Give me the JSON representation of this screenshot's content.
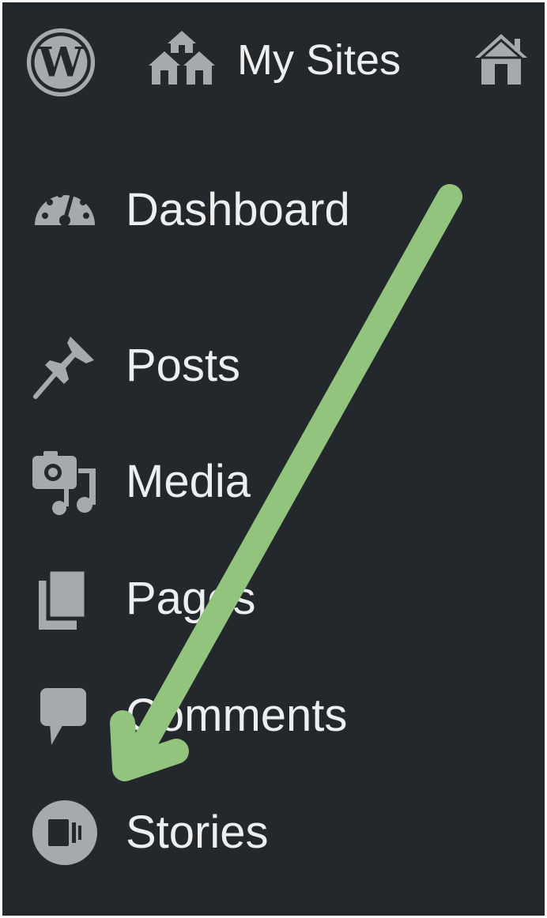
{
  "colors": {
    "sidebar_bg": "#23282d",
    "icon_gray": "#a7aaad",
    "text": "#eeeeee",
    "annotation_arrow": "#93c47d"
  },
  "top_bar": {
    "logo_icon": "wordpress-logo-icon",
    "my_sites_icon": "my-sites-houses-icon",
    "my_sites_label": "My Sites",
    "home_icon": "home-icon"
  },
  "menu": {
    "items": [
      {
        "label": "Dashboard",
        "icon": "dashboard-gauge-icon"
      },
      {
        "label": "Posts",
        "icon": "pushpin-icon"
      },
      {
        "label": "Media",
        "icon": "camera-music-icon"
      },
      {
        "label": "Pages",
        "icon": "pages-icon"
      },
      {
        "label": "Comments",
        "icon": "comment-bubble-icon"
      },
      {
        "label": "Stories",
        "icon": "stories-icon"
      }
    ]
  },
  "annotation": {
    "type": "arrow",
    "points_to": "Stories"
  }
}
